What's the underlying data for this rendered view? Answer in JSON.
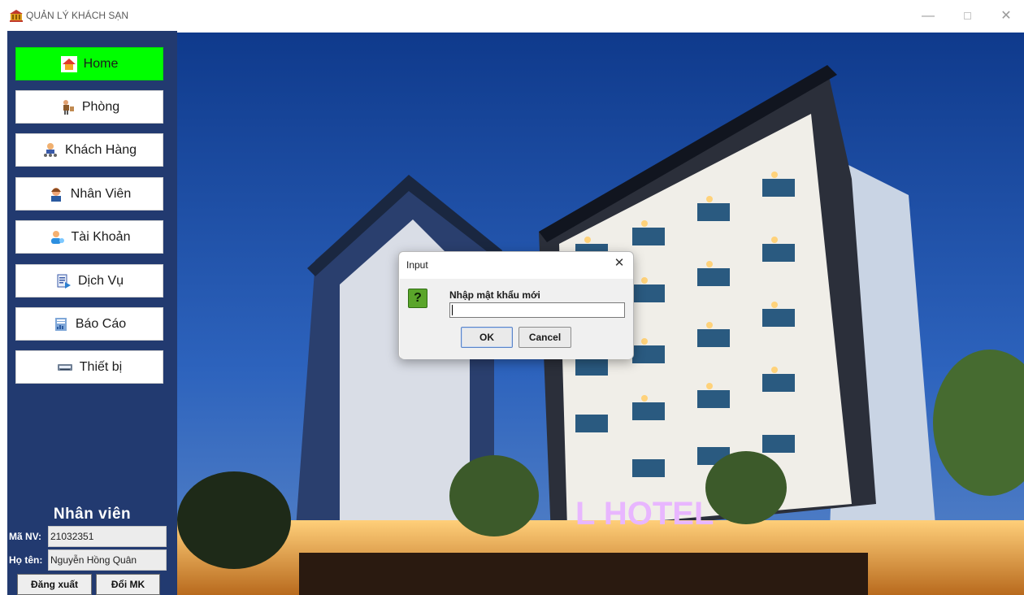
{
  "window": {
    "title": "QUẢN LÝ KHÁCH SẠN",
    "controls": {
      "minimize": "—",
      "close": "✕"
    }
  },
  "sidebar": {
    "items": [
      {
        "label": "Home",
        "icon": "home-icon",
        "active": true
      },
      {
        "label": "Phòng",
        "icon": "bellboy-icon",
        "active": false
      },
      {
        "label": "Khách Hàng",
        "icon": "customers-icon",
        "active": false
      },
      {
        "label": "Nhân Viên",
        "icon": "staff-icon",
        "active": false
      },
      {
        "label": "Tài Khoản",
        "icon": "user-account-icon",
        "active": false
      },
      {
        "label": "Dịch Vụ",
        "icon": "service-icon",
        "active": false
      },
      {
        "label": "Báo Cáo",
        "icon": "report-icon",
        "active": false
      },
      {
        "label": "Thiết bị",
        "icon": "device-icon",
        "active": false
      }
    ],
    "employee": {
      "section_title": "Nhân viên",
      "id_label": "Mã NV:",
      "id_value": "21032351",
      "name_label": "Họ tên:",
      "name_value": "Nguyễn Hồng Quân",
      "logout_label": "Đăng xuất",
      "change_password_label": "Đổi MK"
    }
  },
  "background": {
    "sign_text": "L HOTEL"
  },
  "dialog": {
    "title": "Input",
    "close_glyph": "✕",
    "question_glyph": "?",
    "message": "Nhập mật khẩu mới",
    "input_value": "",
    "ok_label": "OK",
    "cancel_label": "Cancel"
  },
  "colors": {
    "sidebar_bg": "#223a70",
    "active_nav": "#00ff00",
    "sky": "#1c4fa8"
  }
}
